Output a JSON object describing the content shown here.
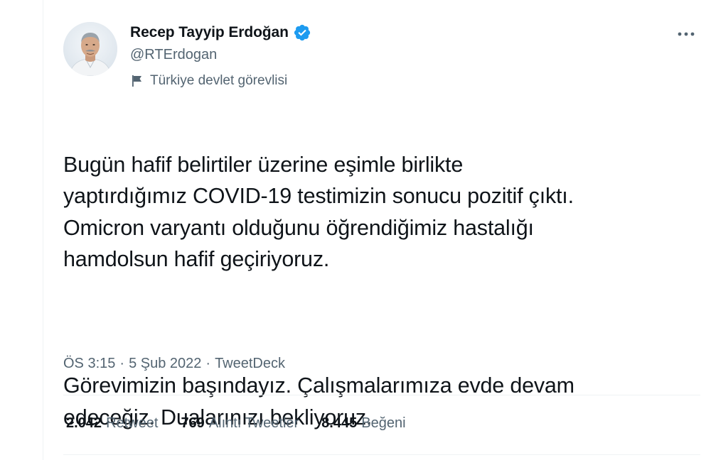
{
  "author": {
    "display_name": "Recep Tayyip Erdoğan",
    "handle": "@RTErdogan",
    "verified_icon": "verified-badge-icon",
    "label_icon": "flag-icon",
    "label_text": "Türkiye devlet görevlisi"
  },
  "menu": {
    "icon": "more-icon"
  },
  "tweet": {
    "paragraph_1": "Bugün hafif belirtiler üzerine eşimle birlikte\nyaptırdığımız COVID-19 testimizin sonucu pozitif çıktı.\nOmicron varyantı olduğunu öğrendiğimiz hastalığı\nhamdolsun hafif geçiriyoruz.",
    "paragraph_2": "Görevimizin başındayız. Çalışmalarımıza evde devam\nedeceğiz. Dualarınızı bekliyoruz."
  },
  "meta": {
    "time": "ÖS 3:15",
    "separator": "·",
    "date": "5 Şub 2022",
    "source": "TweetDeck"
  },
  "stats": {
    "retweets_count": "2.042",
    "retweets_label": "Retweet",
    "quotes_count": "769",
    "quotes_label": "Alıntı Tweetler",
    "likes_count": "8.445",
    "likes_label": "Beğeni"
  },
  "colors": {
    "text_primary": "#0f1419",
    "text_secondary": "#536471",
    "verified_blue": "#1d9bf0",
    "divider": "#eff3f4"
  }
}
